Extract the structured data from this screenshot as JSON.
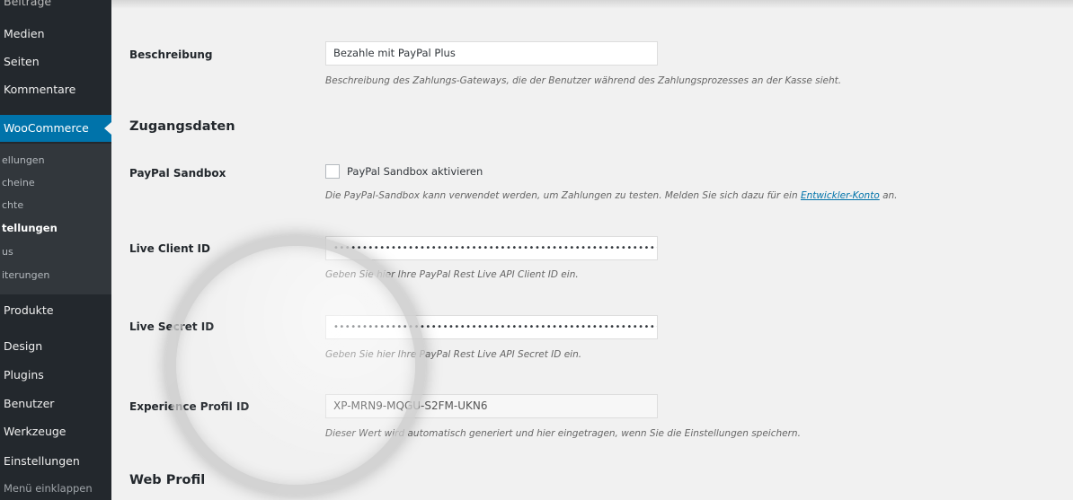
{
  "sidebar": {
    "items": [
      {
        "label": "Beiträge"
      },
      {
        "label": "Medien"
      },
      {
        "label": "Seiten"
      },
      {
        "label": "Kommentare"
      },
      {
        "label": "WooCommerce"
      },
      {
        "label": "Produkte"
      },
      {
        "label": "Design"
      },
      {
        "label": "Plugins"
      },
      {
        "label": "Benutzer"
      },
      {
        "label": "Werkzeuge"
      },
      {
        "label": "Einstellungen"
      },
      {
        "label": "Menü einklappen"
      }
    ],
    "submenu": [
      {
        "label": "ellungen"
      },
      {
        "label": "cheine"
      },
      {
        "label": "chte"
      },
      {
        "label": "tellungen"
      },
      {
        "label": "us"
      },
      {
        "label": "iterungen"
      }
    ]
  },
  "form": {
    "beschreibung": {
      "label": "Beschreibung",
      "value": "Bezahle mit PayPal Plus",
      "desc": "Beschreibung des Zahlungs-Gateways, die der Benutzer während des Zahlungsprozesses an der Kasse sieht."
    },
    "zugangsdaten_title": "Zugangsdaten",
    "sandbox": {
      "label": "PayPal Sandbox",
      "checkbox_label": "PayPal Sandbox aktivieren",
      "checked": false,
      "desc_prefix": "Die PayPal-Sandbox kann verwendet werden, um Zahlungen zu testen. Melden Sie sich dazu für ein ",
      "desc_link": "Entwickler-Konto",
      "desc_suffix": " an."
    },
    "live_client_id": {
      "label": "Live Client ID",
      "value": "••••••••••••••••••••••••••••••••••••••••••••••••••••••••••••••••••••••••••",
      "desc": "Geben Sie hier Ihre PayPal Rest Live API Client ID ein."
    },
    "live_secret_id": {
      "label": "Live Secret ID",
      "value": "••••••••••••••••••••••••••••••••••••••••••••••••••••••••••••••••••••••••••",
      "desc": "Geben Sie hier Ihre PayPal Rest Live API Secret ID ein."
    },
    "experience_profil_id": {
      "label": "Experience Profil ID",
      "value": "XP-MRN9-MQGU-S2FM-UKN6",
      "desc": "Dieser Wert wird automatisch generiert und hier eingetragen, wenn Sie die Einstellungen speichern."
    },
    "web_profil_title": "Web Profil"
  },
  "colors": {
    "sidebar_bg": "#23282d",
    "active_bg": "#0073aa",
    "link": "#0073aa",
    "content_bg": "#f1f1f1"
  }
}
